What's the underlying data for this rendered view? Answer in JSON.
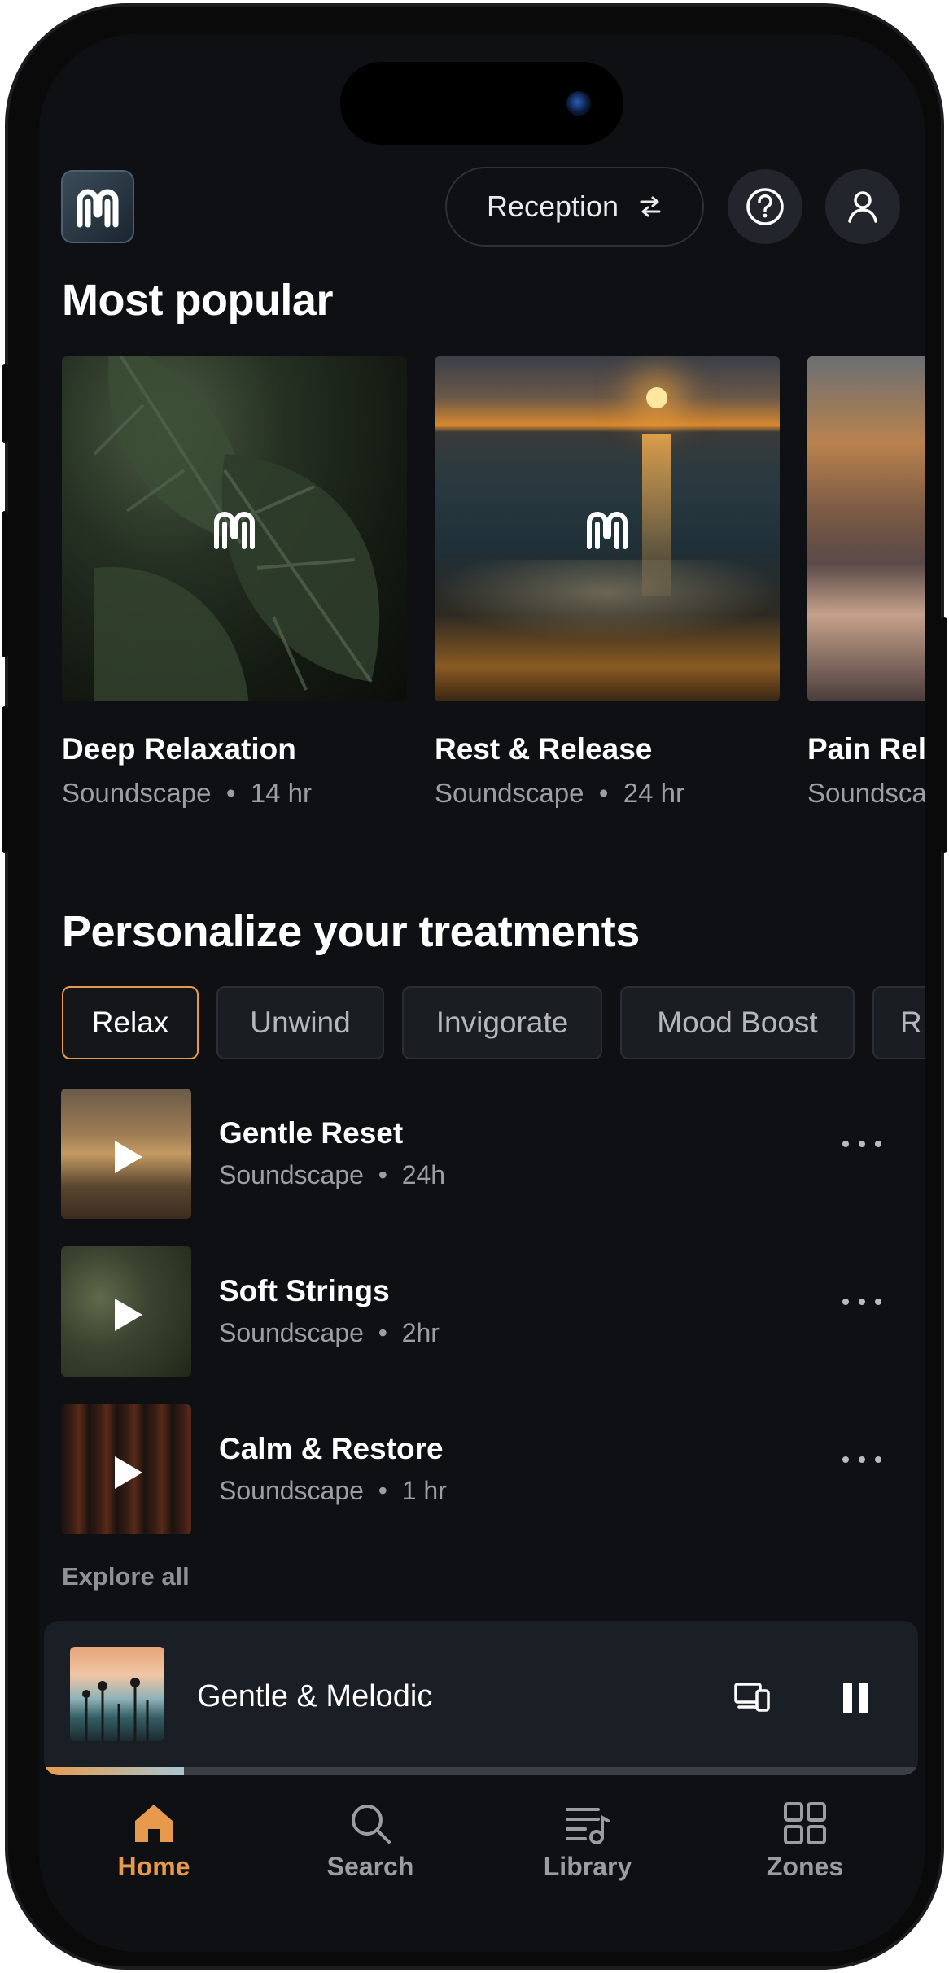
{
  "header": {
    "zone_label": "Reception",
    "help_icon": "question-circle-icon",
    "profile_icon": "user-icon",
    "logo_icon": "brand-logo-icon"
  },
  "most_popular": {
    "title": "Most popular",
    "cards": [
      {
        "title": "Deep Relaxation",
        "type": "Soundscape",
        "duration": "14 hr"
      },
      {
        "title": "Rest & Release",
        "type": "Soundscape",
        "duration": "24 hr"
      },
      {
        "title": "Pain Reli",
        "type": "Soundsca",
        "duration": ""
      }
    ]
  },
  "personalize": {
    "title": "Personalize your treatments",
    "chips": [
      {
        "label": "Relax",
        "active": true
      },
      {
        "label": "Unwind",
        "active": false
      },
      {
        "label": "Invigorate",
        "active": false
      },
      {
        "label": "Mood Boost",
        "active": false
      },
      {
        "label": "R",
        "active": false
      }
    ],
    "tracks": [
      {
        "title": "Gentle Reset",
        "type": "Soundscape",
        "duration": "24h"
      },
      {
        "title": "Soft Strings",
        "type": "Soundscape",
        "duration": "2hr"
      },
      {
        "title": "Calm & Restore",
        "type": "Soundscape",
        "duration": "1 hr"
      }
    ],
    "explore_label": "Explore all"
  },
  "now_playing": {
    "title": "Gentle & Melodic",
    "progress": 0.16,
    "device_icon": "devices-icon",
    "pause_icon": "pause-icon"
  },
  "tabs": [
    {
      "label": "Home",
      "icon": "home-icon",
      "active": true
    },
    {
      "label": "Search",
      "icon": "search-icon",
      "active": false
    },
    {
      "label": "Library",
      "icon": "library-icon",
      "active": false
    },
    {
      "label": "Zones",
      "icon": "grid-icon",
      "active": false
    }
  ],
  "colors": {
    "accent": "#e89a4c",
    "background": "#0e1013",
    "muted_text": "#9b9ea4"
  },
  "separator": "•"
}
